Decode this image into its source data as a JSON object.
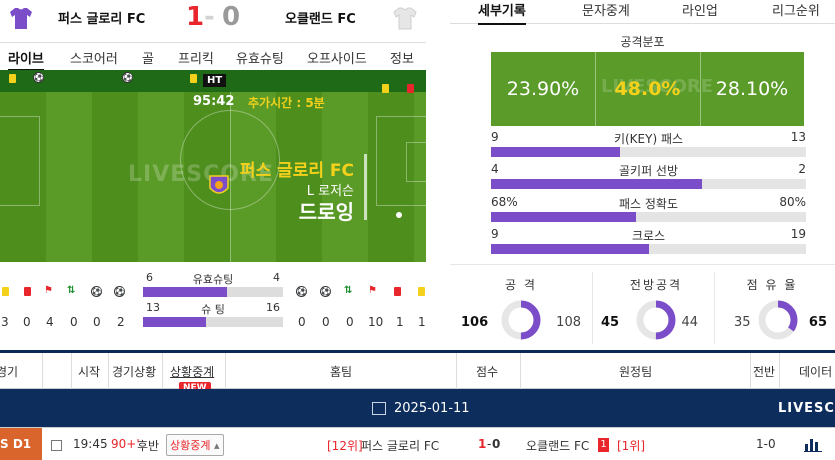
{
  "match": {
    "home_team": "퍼스 글로리 FC",
    "away_team": "오클랜드 FC",
    "home_score": "1",
    "separator": "-",
    "away_score": "0",
    "home_jersey_color": "#7b4dc9",
    "away_jersey_color": "#e0e0e0"
  },
  "live_tabs": [
    "라이브",
    "스코어러",
    "골",
    "프리킥",
    "유효슈팅",
    "오프사이드",
    "정보"
  ],
  "pitch": {
    "ht_badge": "HT",
    "match_time": "95:42",
    "added_time": "추가시간 : 5분",
    "watermark": "LIVESCORE",
    "event_team": "퍼스 글로리 FC",
    "event_player": "L 로저슨",
    "event_type": "드로잉"
  },
  "left_stats": {
    "home_counts": [
      "3",
      "0",
      "4",
      "0",
      "0",
      "2"
    ],
    "away_counts": [
      "0",
      "0",
      "0",
      "10",
      "1",
      "1"
    ],
    "shots_on_target": {
      "label": "유효슈팅",
      "home": "6",
      "away": "4",
      "home_ratio": 0.6
    },
    "shots": {
      "label": "슈  팅",
      "home": "13",
      "away": "16",
      "home_ratio": 0.45
    }
  },
  "right_tabs": [
    "세부기록",
    "문자중계",
    "라인업",
    "리그순위"
  ],
  "attack_distribution": {
    "title": "공격분포",
    "left": "23.90%",
    "center": "48.0%",
    "right": "28.10%",
    "watermark": "LIVESCORE"
  },
  "bar_stats": [
    {
      "label": "키(KEY) 패스",
      "home": "9",
      "away": "13",
      "home_ratio": 0.41
    },
    {
      "label": "골키퍼 선방",
      "home": "4",
      "away": "2",
      "home_ratio": 0.67
    },
    {
      "label": "패스 정확도",
      "home": "68%",
      "away": "80%",
      "home_ratio": 0.46
    },
    {
      "label": "크로스",
      "home": "9",
      "away": "19",
      "home_ratio": 0.5
    }
  ],
  "donuts": [
    {
      "title": "공 격",
      "home": "106",
      "away": "108",
      "home_ratio": 0.5
    },
    {
      "title": "전방공격",
      "home": "45",
      "away": "44",
      "home_ratio": 0.5
    },
    {
      "title": "점 유 율",
      "home": "35",
      "away": "65",
      "home_ratio": 0.35
    }
  ],
  "table": {
    "headers": [
      "경기",
      "시작",
      "경기상황",
      "상황중계",
      "홈팀",
      "점수",
      "원정팀",
      "전반",
      "데이터"
    ],
    "new_badge": "NEW",
    "date": "2025-01-11",
    "brand": "LIVESCO",
    "row": {
      "league": "S D1",
      "start": "19:45",
      "status_time": "90+'",
      "status": "후반",
      "live_button": "상황중계",
      "home_rank": "[12위]",
      "home_team": "퍼스 글로리 FC",
      "home_score": "1",
      "dash": "-",
      "away_score": "0",
      "away_team": "오클랜드 FC",
      "away_red_cards": "1",
      "away_rank": "[1위]",
      "first_half": "1-0"
    }
  },
  "colors": {
    "accent_purple": "#7b4dc9",
    "score_red": "#e8262c",
    "pitch_green": "#5a9a27",
    "navy": "#0d2d5c",
    "highlight_yellow": "#f4d21c"
  }
}
